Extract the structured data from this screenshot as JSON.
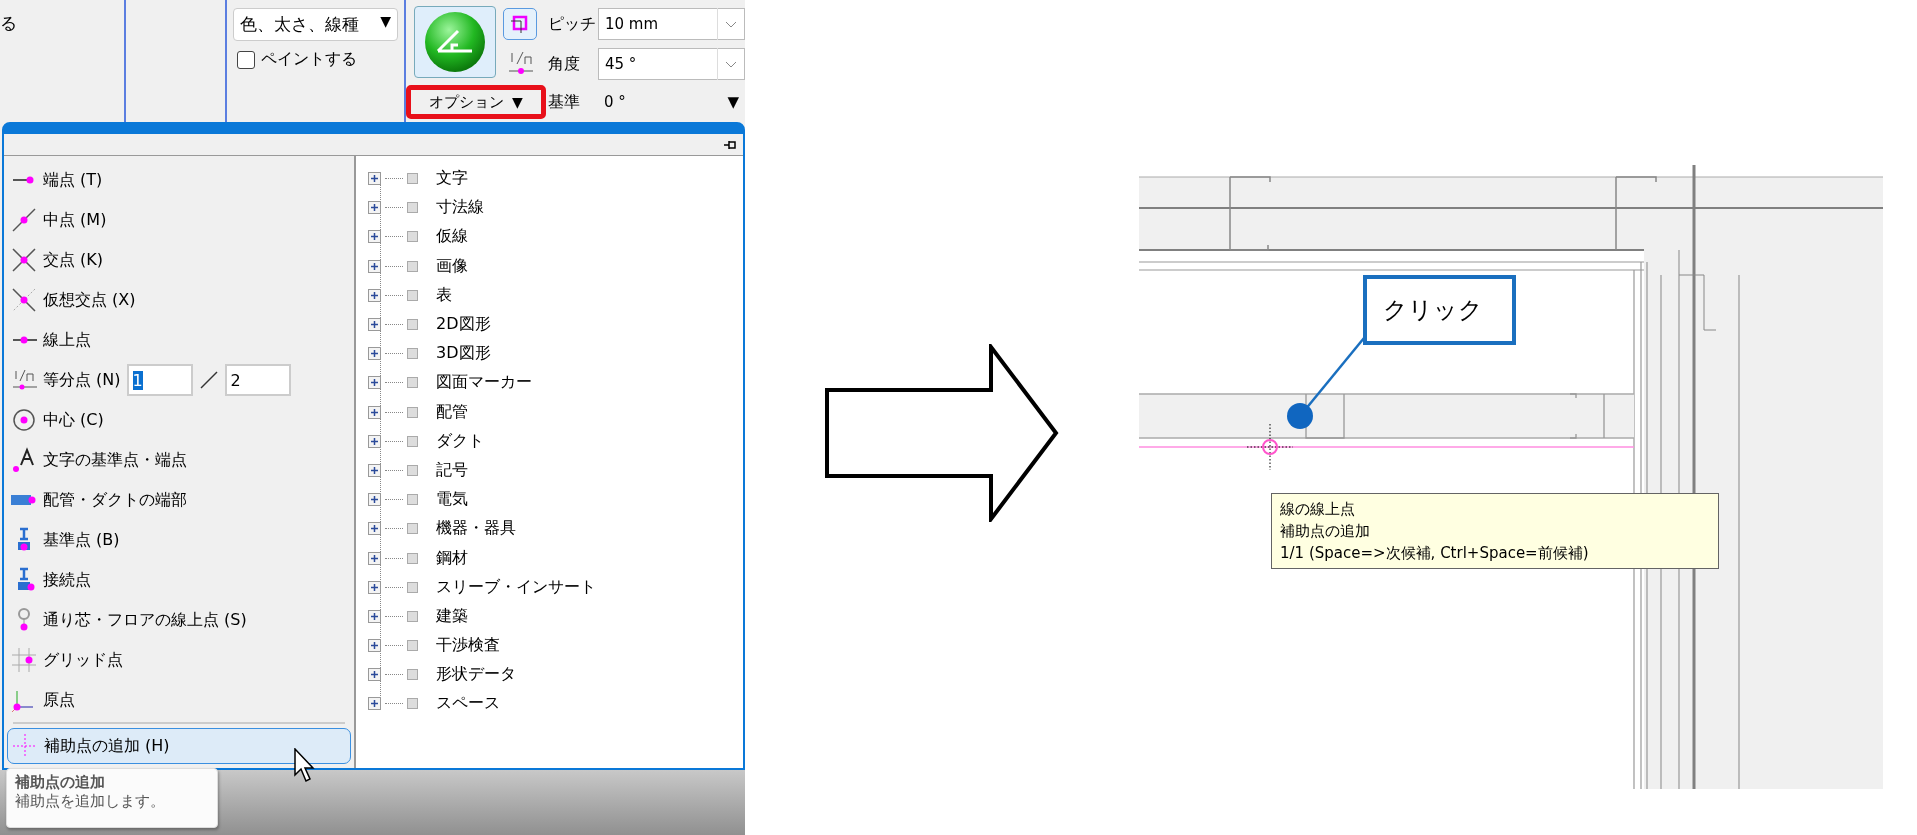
{
  "ribbon": {
    "cut_label": "る",
    "line_style_dropdown": {
      "value": "色、太さ、線種",
      "caret": "▼"
    },
    "paint_checkbox": {
      "label": "ペイントする",
      "checked": false
    },
    "snap_group": {
      "pitch_label": "ピッチ",
      "pitch_value": "10 mm",
      "angle_label": "角度",
      "angle_value": "45 °",
      "base_label": "基準",
      "base_value": "0 °",
      "base_caret": "▼",
      "options_button": {
        "label": "オプション",
        "caret": "▼",
        "highlighted": true
      }
    }
  },
  "snap_panel": {
    "snap_items": [
      {
        "kind": "endpoint",
        "label": "端点 (T)",
        "selected": false
      },
      {
        "kind": "midpoint",
        "label": "中点 (M)",
        "selected": false
      },
      {
        "kind": "intersection",
        "label": "交点 (K)",
        "selected": false
      },
      {
        "kind": "virtual-intersection",
        "label": "仮想交点 (X)",
        "selected": false
      },
      {
        "kind": "on-line",
        "label": "線上点",
        "selected": false
      },
      {
        "kind": "division",
        "label": "等分点 (N)",
        "selected": false,
        "numerator": "1",
        "denominator": "2"
      },
      {
        "kind": "center",
        "label": "中心 (C)",
        "selected": false
      },
      {
        "kind": "text-base",
        "label": "文字の基準点・端点",
        "selected": false
      },
      {
        "kind": "pipe-end",
        "label": "配管・ダクトの端部",
        "selected": false
      },
      {
        "kind": "base-point",
        "label": "基準点 (B)",
        "selected": false
      },
      {
        "kind": "connection",
        "label": "接続点",
        "selected": false
      },
      {
        "kind": "grid-line",
        "label": "通り芯・フロアの線上点 (S)",
        "selected": false
      },
      {
        "kind": "grid-point",
        "label": "グリッド点",
        "selected": false
      },
      {
        "kind": "origin",
        "label": "原点",
        "selected": false
      },
      {
        "kind": "aux-point",
        "label": "補助点の追加 (H)",
        "selected": true
      }
    ],
    "layer_tree": [
      {
        "label": "文字",
        "expanded": false
      },
      {
        "label": "寸法線",
        "expanded": false
      },
      {
        "label": "仮線",
        "expanded": false
      },
      {
        "label": "画像",
        "expanded": false
      },
      {
        "label": "表",
        "expanded": false
      },
      {
        "label": "2D図形",
        "expanded": false
      },
      {
        "label": "3D図形",
        "expanded": false
      },
      {
        "label": "図面マーカー",
        "expanded": false
      },
      {
        "label": "配管",
        "expanded": false
      },
      {
        "label": "ダクト",
        "expanded": false
      },
      {
        "label": "記号",
        "expanded": false
      },
      {
        "label": "電気",
        "expanded": false
      },
      {
        "label": "機器・器具",
        "expanded": false
      },
      {
        "label": "鋼材",
        "expanded": false
      },
      {
        "label": "スリーブ・インサート",
        "expanded": false
      },
      {
        "label": "建築",
        "expanded": false
      },
      {
        "label": "干渉検査",
        "expanded": false
      },
      {
        "label": "形状データ",
        "expanded": false
      },
      {
        "label": "スペース",
        "expanded": false
      }
    ],
    "tooltip": {
      "title": "補助点の追加",
      "description": "補助点を追加します。"
    }
  },
  "canvas": {
    "callout": "クリック",
    "snap_tooltip": [
      "線の線上点",
      "補助点の追加",
      "1/1 (Space=>次候補, Ctrl+Space=前候補)"
    ]
  }
}
